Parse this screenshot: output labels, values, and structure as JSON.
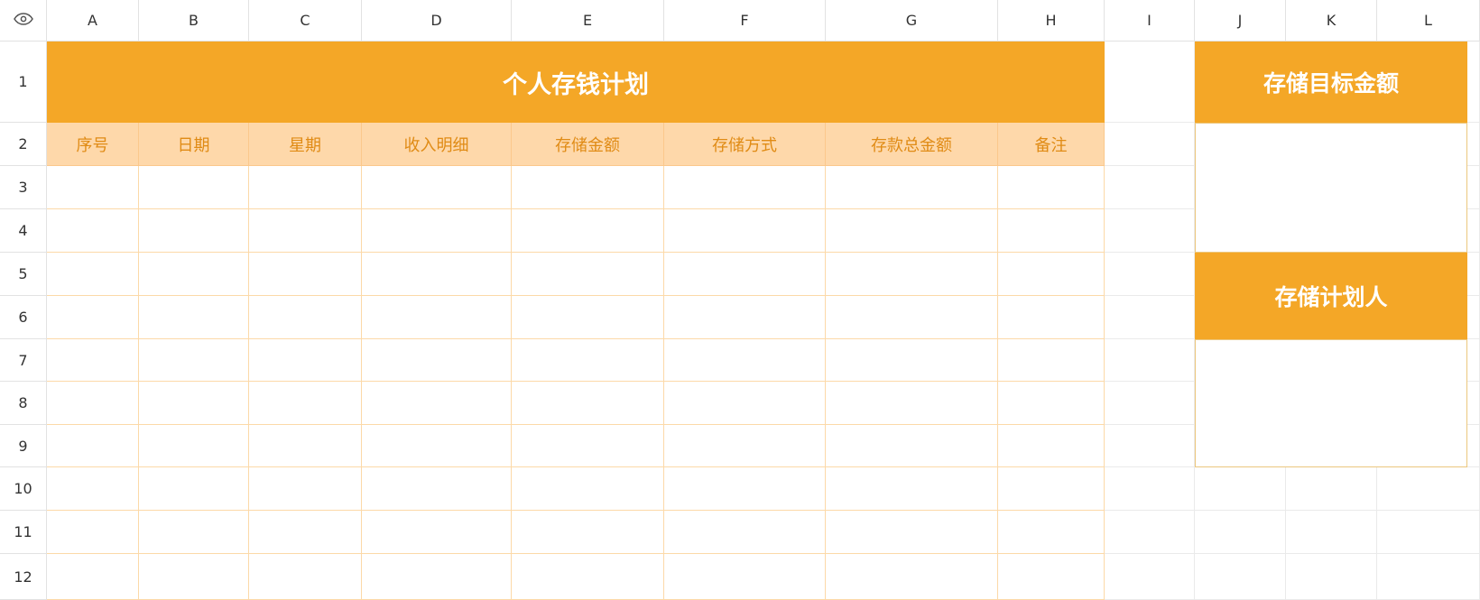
{
  "columns": [
    "A",
    "B",
    "C",
    "D",
    "E",
    "F",
    "G",
    "H",
    "I",
    "J",
    "K",
    "L"
  ],
  "rows": [
    "1",
    "2",
    "3",
    "4",
    "5",
    "6",
    "7",
    "8",
    "9",
    "10",
    "11",
    "12"
  ],
  "corner_icon": "eye-icon",
  "sheet": {
    "title": "个人存钱计划",
    "headers": [
      "序号",
      "日期",
      "星期",
      "收入明细",
      "存储金额",
      "存储方式",
      "存款总金额",
      "备注"
    ]
  },
  "side": {
    "target_title": "存储目标金额",
    "planner_title": "存储计划人"
  },
  "colors": {
    "accent": "#f4a727",
    "header_fill": "#fed8aa",
    "header_text": "#e08b15",
    "table_border": "#fcd9a8"
  }
}
